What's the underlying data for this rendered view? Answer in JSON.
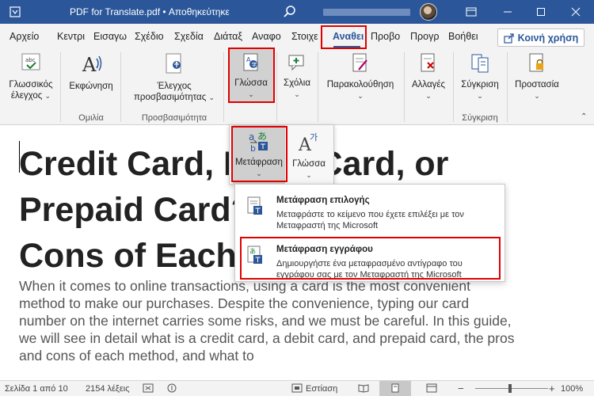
{
  "titlebar": {
    "title": "PDF for Translate.pdf  •  Αποθηκεύτηκε",
    "app_icon": "word-icon",
    "search_icon": "search-icon",
    "controls": [
      "ribbon-display-icon",
      "minimize-icon",
      "maximize-icon",
      "close-icon"
    ]
  },
  "tabs": {
    "items": [
      {
        "label": "Αρχείο"
      },
      {
        "label": "Κεντρι"
      },
      {
        "label": "Εισαγω"
      },
      {
        "label": "Σχέδιο"
      },
      {
        "label": "Σχεδία"
      },
      {
        "label": "Διάταξ"
      },
      {
        "label": "Αναφο"
      },
      {
        "label": "Στοιχε"
      },
      {
        "label": "Αναθει"
      },
      {
        "label": "Προβο"
      },
      {
        "label": "Προγρ"
      },
      {
        "label": "Βοήθει"
      }
    ],
    "active": "Αναθει",
    "share_label": "Κοινή χρήση"
  },
  "ribbon": {
    "buttons": {
      "proofing": {
        "line1": "Γλωσσικός",
        "line2": "έλεγχος"
      },
      "speech": {
        "label": "Εκφώνηση"
      },
      "accessibility": {
        "line1": "Έλεγχος",
        "line2": "προσβασιμότητας"
      },
      "language": {
        "label": "Γλώσσα"
      },
      "comments": {
        "label": "Σχόλια"
      },
      "tracking": {
        "label": "Παρακολούθηση"
      },
      "changes": {
        "label": "Αλλαγές"
      },
      "compare": {
        "label": "Σύγκριση"
      },
      "protect": {
        "label": "Προστασία"
      }
    },
    "groups": {
      "speech": "Ομιλία",
      "accessibility": "Προσβασιμότητα",
      "compare": "Σύγκριση"
    }
  },
  "language_popup": {
    "translate_label": "Μετάφραση",
    "language_label": "Γλώσσα"
  },
  "translate_menu": {
    "items": [
      {
        "title": "Μετάφραση επιλογής",
        "desc": "Μεταφράστε το κείμενο που έχετε επιλέξει με τον Μεταφραστή της Microsoft"
      },
      {
        "title": "Μετάφραση εγγράφου",
        "desc": "Δημιουργήστε ένα μεταφρασμένο αντίγραφο του εγγράφου σας με τον Μεταφραστή της Microsoft"
      }
    ]
  },
  "document": {
    "heading_lines": [
      "Credit Card,  Debit Card, or",
      "Prepaid Card? Pros and",
      "Cons of Each"
    ],
    "body": "When it comes to online transactions, using a card is the most convenient method to make our purchases. Despite the convenience, typing our card number on the internet carries some risks, and we must be careful. In this guide, we will see in detail what is a credit card, a debit card, and prepaid card, the pros and cons of each method, and what to"
  },
  "statusbar": {
    "page": "Σελίδα 1 από 10",
    "words": "2154 λέξεις",
    "focus": "Εστίαση",
    "zoom": "100%",
    "zoom_minus": "−",
    "zoom_plus": "+"
  },
  "colors": {
    "brand": "#2b579a",
    "highlight": "#e00000"
  }
}
